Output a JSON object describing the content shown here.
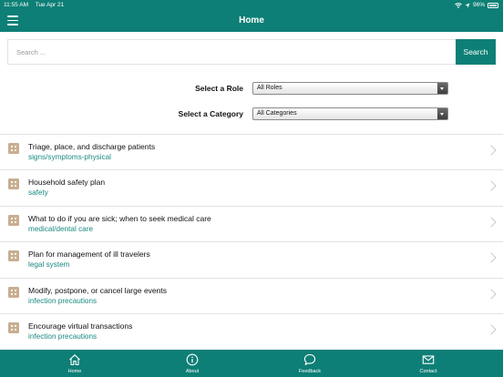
{
  "status_bar": {
    "time": "11:55 AM",
    "date": "Tue Apr 21",
    "battery": "96%"
  },
  "header": {
    "title": "Home",
    "menu_icon": "hamburger-icon"
  },
  "search": {
    "placeholder": "Search ...",
    "button_label": "Search"
  },
  "filters": {
    "role": {
      "label": "Select a Role",
      "selected": "All Roles"
    },
    "category": {
      "label": "Select a Category",
      "selected": "All Categories"
    }
  },
  "tasks": [
    {
      "title": "Triage, place, and discharge patients",
      "category": "signs/symptoms-physical"
    },
    {
      "title": "Household safety plan",
      "category": "safety"
    },
    {
      "title": "What to do if you are sick; when to seek medical care",
      "category": "medical/dental care"
    },
    {
      "title": "Plan for management of ill travelers",
      "category": "legal system"
    },
    {
      "title": "Modify, postpone, or cancel large events",
      "category": "infection precautions"
    },
    {
      "title": "Encourage virtual transactions",
      "category": "infection precautions"
    }
  ],
  "tab_bar": [
    {
      "label": "Home",
      "icon": "home-icon"
    },
    {
      "label": "About",
      "icon": "info-icon"
    },
    {
      "label": "Feedback",
      "icon": "chat-bubble-icon"
    },
    {
      "label": "Contact",
      "icon": "envelope-icon"
    }
  ],
  "colors": {
    "primary": "#0e7f76",
    "category_text": "#1a8a80",
    "task_icon": "#c8ae90"
  }
}
